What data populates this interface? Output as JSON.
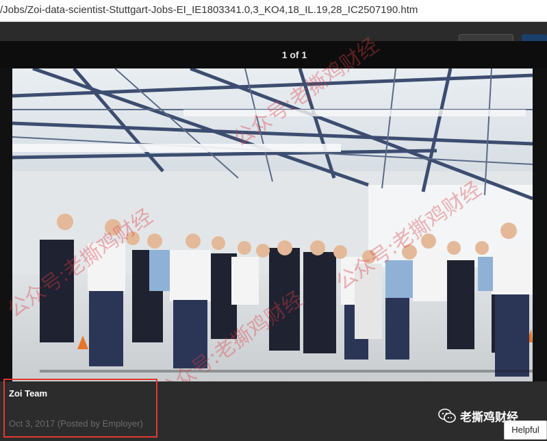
{
  "browser": {
    "url": "/Jobs/Zoi-data-scientist-Stuttgart-Jobs-EI_IE1803341.0,3_KO4,18_IL.19,28_IC2507190.htm"
  },
  "lightbox": {
    "counter": "1 of 1"
  },
  "caption": {
    "title": "Zoi Team",
    "date_posted": "Oct 3, 2017 (Posted by Employer)"
  },
  "actions": {
    "helpful_label": "Helpful"
  },
  "watermark": {
    "account_name": "老撕鸡财经",
    "diagonal_texts": [
      "公众号:老撕鸡财经",
      "公众号:老撕鸡财经",
      "公众号:老撕鸡财经",
      "公众号:老撕鸡财经"
    ]
  },
  "colors": {
    "header_bg": "#0d0d0d",
    "highlight_box": "#e03a2f",
    "watermark": "#dc3c46"
  }
}
